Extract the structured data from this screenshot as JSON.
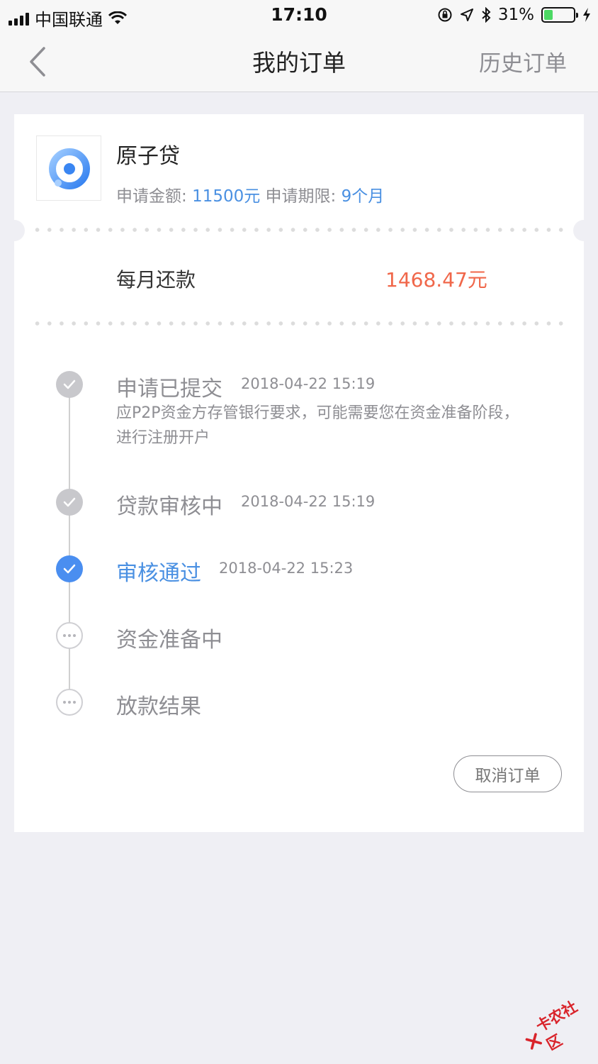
{
  "status_bar": {
    "carrier": "中国联通",
    "time": "17:10",
    "battery": "31%"
  },
  "nav": {
    "title": "我的订单",
    "history": "历史订单"
  },
  "order": {
    "product_name": "原子贷",
    "amount_label": "申请金额: ",
    "amount_value": "11500元",
    "term_label": "申请期限: ",
    "term_value": "9个月",
    "monthly_label": "每月还款",
    "monthly_value": "1468.47元"
  },
  "timeline": [
    {
      "title": "申请已提交",
      "time": "2018-04-22 15:19",
      "status": "done",
      "desc": "应P2P资金方存管银行要求，可能需要您在资金准备阶段，进行注册开户"
    },
    {
      "title": "贷款审核中",
      "time": "2018-04-22 15:19",
      "status": "done"
    },
    {
      "title": "审核通过",
      "time": "2018-04-22 15:23",
      "status": "active"
    },
    {
      "title": "资金准备中",
      "time": "",
      "status": "pending"
    },
    {
      "title": "放款结果",
      "time": "",
      "status": "pending"
    }
  ],
  "actions": {
    "cancel": "取消订单"
  },
  "watermark": "卡农社区",
  "colors": {
    "accent_blue": "#4a90e2",
    "payment_orange": "#f0674a",
    "background": "#efeff4"
  }
}
